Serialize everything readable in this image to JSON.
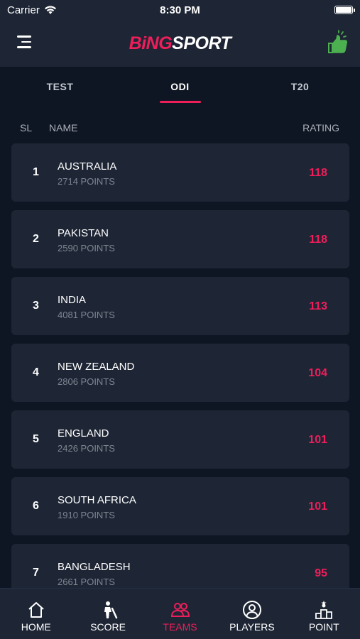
{
  "status_bar": {
    "carrier": "Carrier",
    "time": "8:30 PM"
  },
  "header": {
    "logo_part1": "BiNG",
    "logo_part2": "SPORT"
  },
  "tabs": [
    {
      "label": "TEST",
      "active": false
    },
    {
      "label": "ODI",
      "active": true
    },
    {
      "label": "T20",
      "active": false
    }
  ],
  "columns": {
    "sl": "SL",
    "name": "NAME",
    "rating": "RATING"
  },
  "rankings": [
    {
      "rank": "1",
      "team": "AUSTRALIA",
      "points": "2714 POINTS",
      "rating": "118"
    },
    {
      "rank": "2",
      "team": "PAKISTAN",
      "points": "2590 POINTS",
      "rating": "118"
    },
    {
      "rank": "3",
      "team": "INDIA",
      "points": "4081 POINTS",
      "rating": "113"
    },
    {
      "rank": "4",
      "team": "NEW ZEALAND",
      "points": "2806 POINTS",
      "rating": "104"
    },
    {
      "rank": "5",
      "team": "ENGLAND",
      "points": "2426 POINTS",
      "rating": "101"
    },
    {
      "rank": "6",
      "team": "SOUTH AFRICA",
      "points": "1910 POINTS",
      "rating": "101"
    },
    {
      "rank": "7",
      "team": "BANGLADESH",
      "points": "2661 POINTS",
      "rating": "95"
    }
  ],
  "bottom_nav": [
    {
      "label": "HOME",
      "icon": "home-icon",
      "active": false
    },
    {
      "label": "SCORE",
      "icon": "batsman-icon",
      "active": false
    },
    {
      "label": "TEAMS",
      "icon": "team-icon",
      "active": true
    },
    {
      "label": "PLAYERS",
      "icon": "player-icon",
      "active": false
    },
    {
      "label": "POINT",
      "icon": "podium-icon",
      "active": false
    }
  ],
  "colors": {
    "accent": "#ee1e5a",
    "background": "#0f1623",
    "card": "#1e2635",
    "like": "#4caf50"
  }
}
